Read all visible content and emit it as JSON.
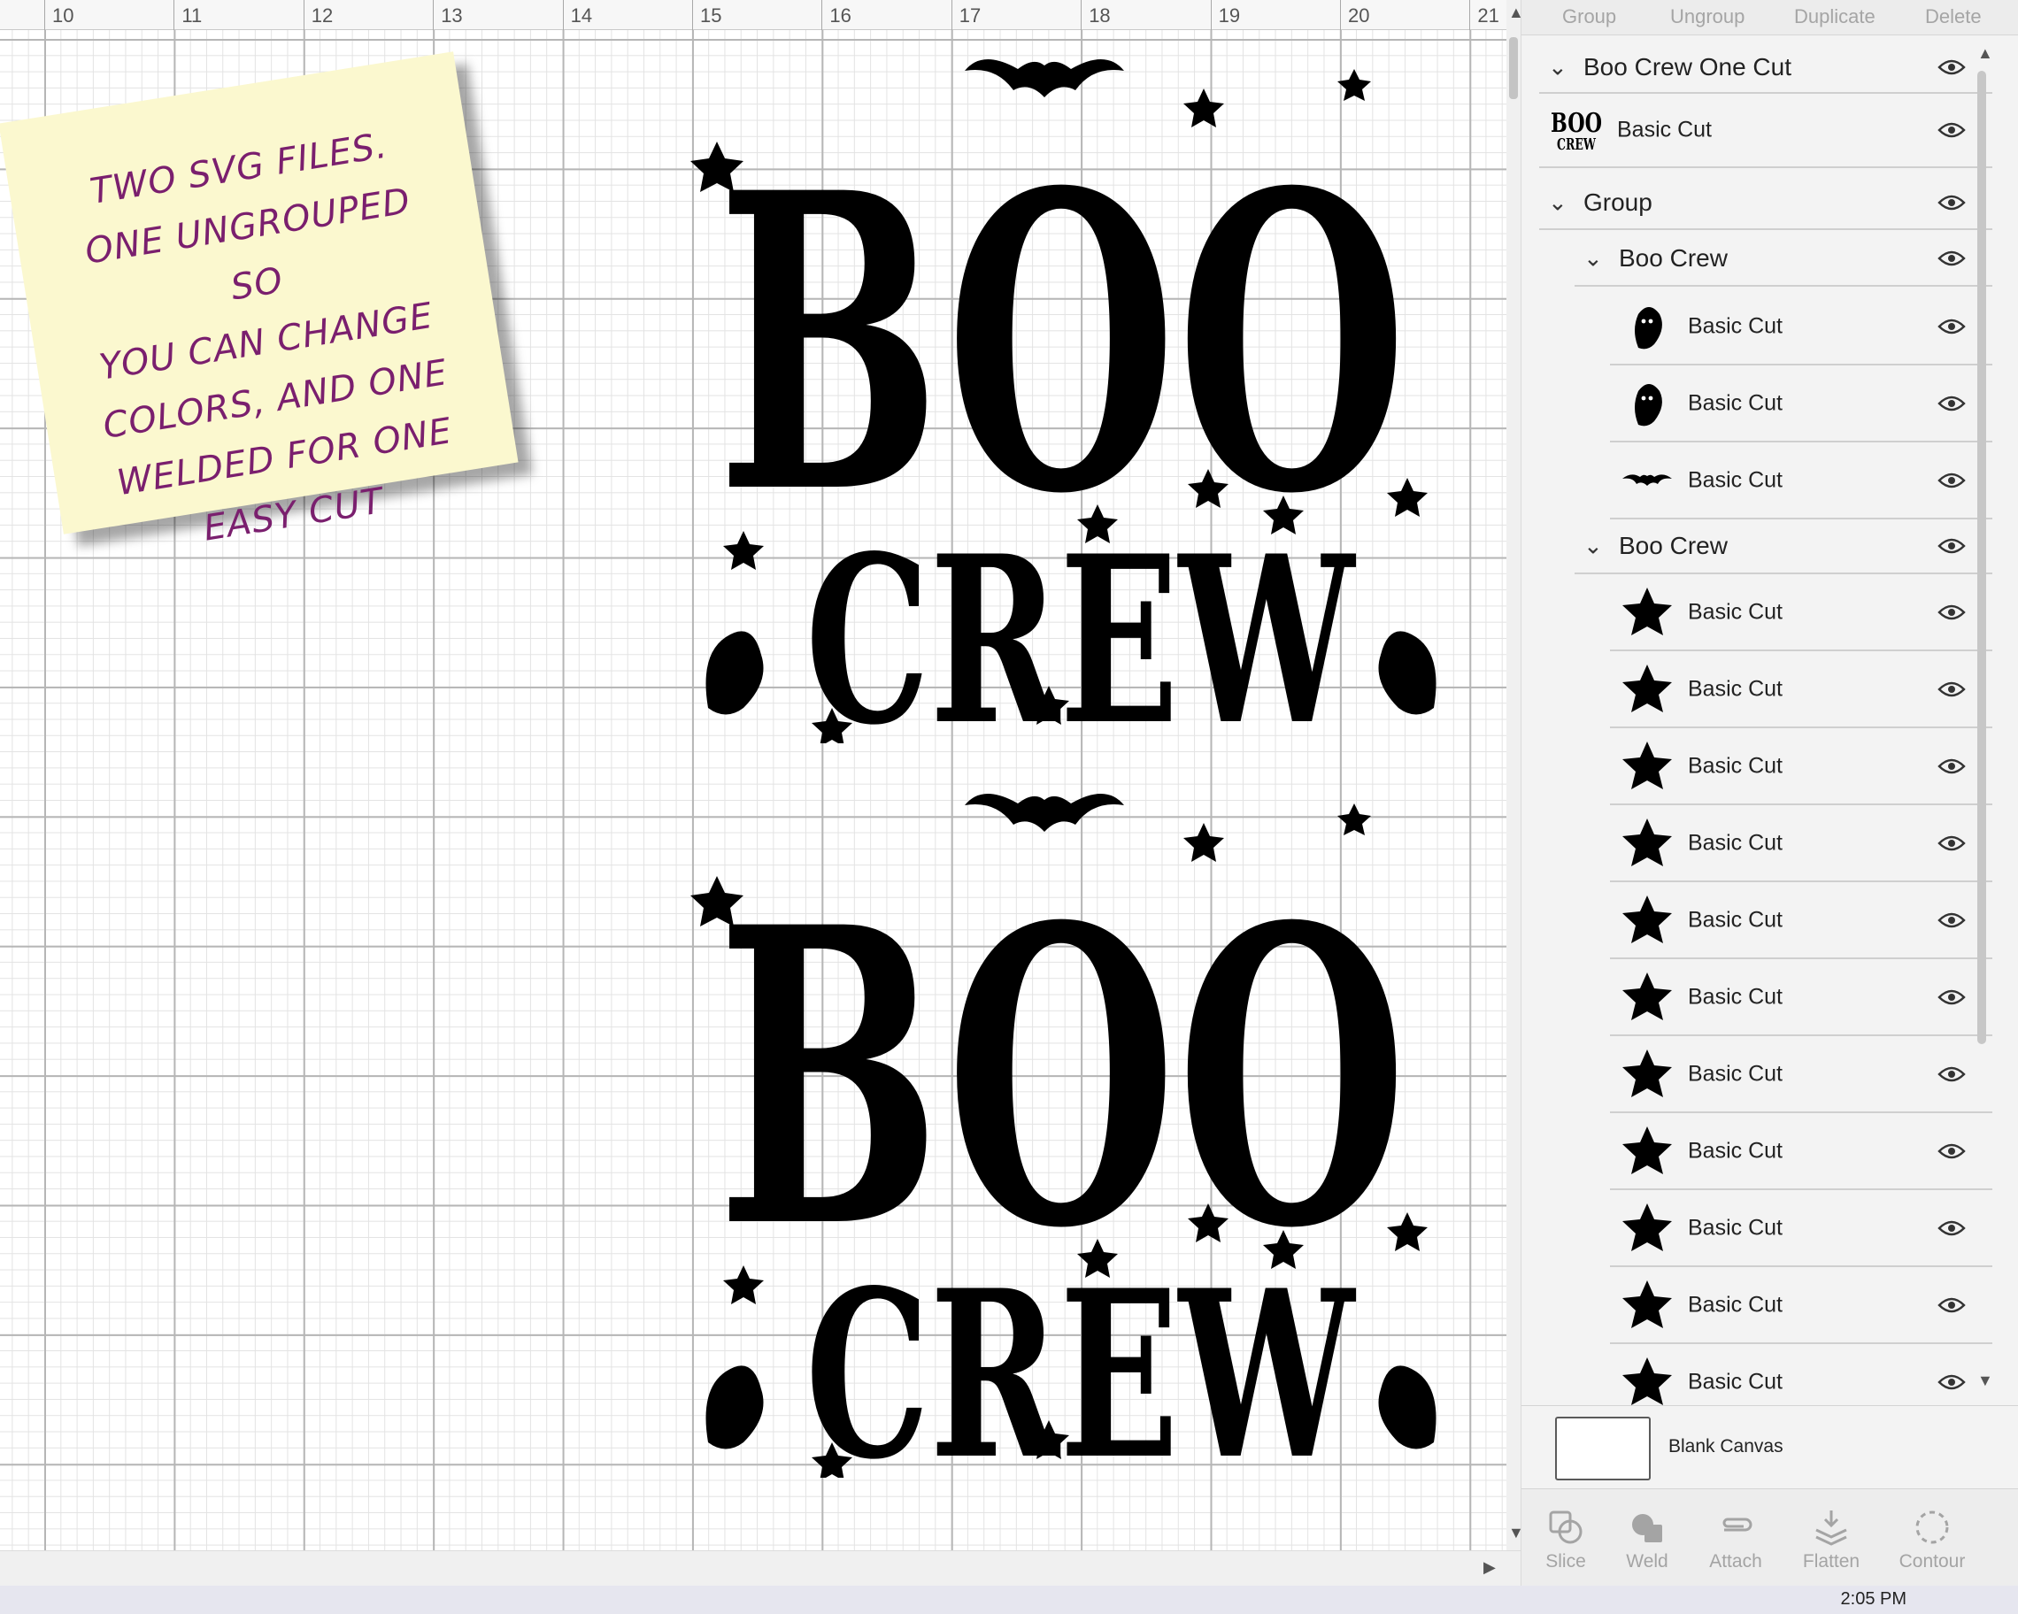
{
  "ruler": {
    "labels": [
      "10",
      "11",
      "12",
      "13",
      "14",
      "15",
      "16",
      "17",
      "18",
      "19",
      "20",
      "21"
    ]
  },
  "note": {
    "lines": [
      "TWO SVG FILES.",
      "ONE UNGROUPED SO",
      "YOU CAN CHANGE",
      "COLORS, AND ONE",
      "WELDED FOR ONE",
      "EASY CUT"
    ]
  },
  "design": {
    "line1": "BOO",
    "line2": "CREW"
  },
  "toolbar": {
    "group": "Group",
    "ungroup": "Ungroup",
    "duplicate": "Duplicate",
    "delete": "Delete"
  },
  "layers": {
    "one_cut": {
      "title": "Boo Crew One Cut",
      "child": "Basic Cut"
    },
    "group": {
      "title": "Group"
    },
    "sub1": {
      "title": "Boo Crew",
      "items": [
        "Basic Cut",
        "Basic Cut",
        "Basic Cut"
      ]
    },
    "sub2": {
      "title": "Boo Crew",
      "items": [
        "Basic Cut",
        "Basic Cut",
        "Basic Cut",
        "Basic Cut",
        "Basic Cut",
        "Basic Cut",
        "Basic Cut",
        "Basic Cut",
        "Basic Cut",
        "Basic Cut",
        "Basic Cut"
      ]
    }
  },
  "blank_canvas": {
    "label": "Blank Canvas"
  },
  "tools": {
    "slice": "Slice",
    "weld": "Weld",
    "attach": "Attach",
    "flatten": "Flatten",
    "contour": "Contour"
  },
  "taskbar": {
    "clock": "2:05 PM"
  },
  "colors": {
    "note_text": "#7a1f6e",
    "note_bg": "#fbf8cf",
    "design": "#000000"
  }
}
